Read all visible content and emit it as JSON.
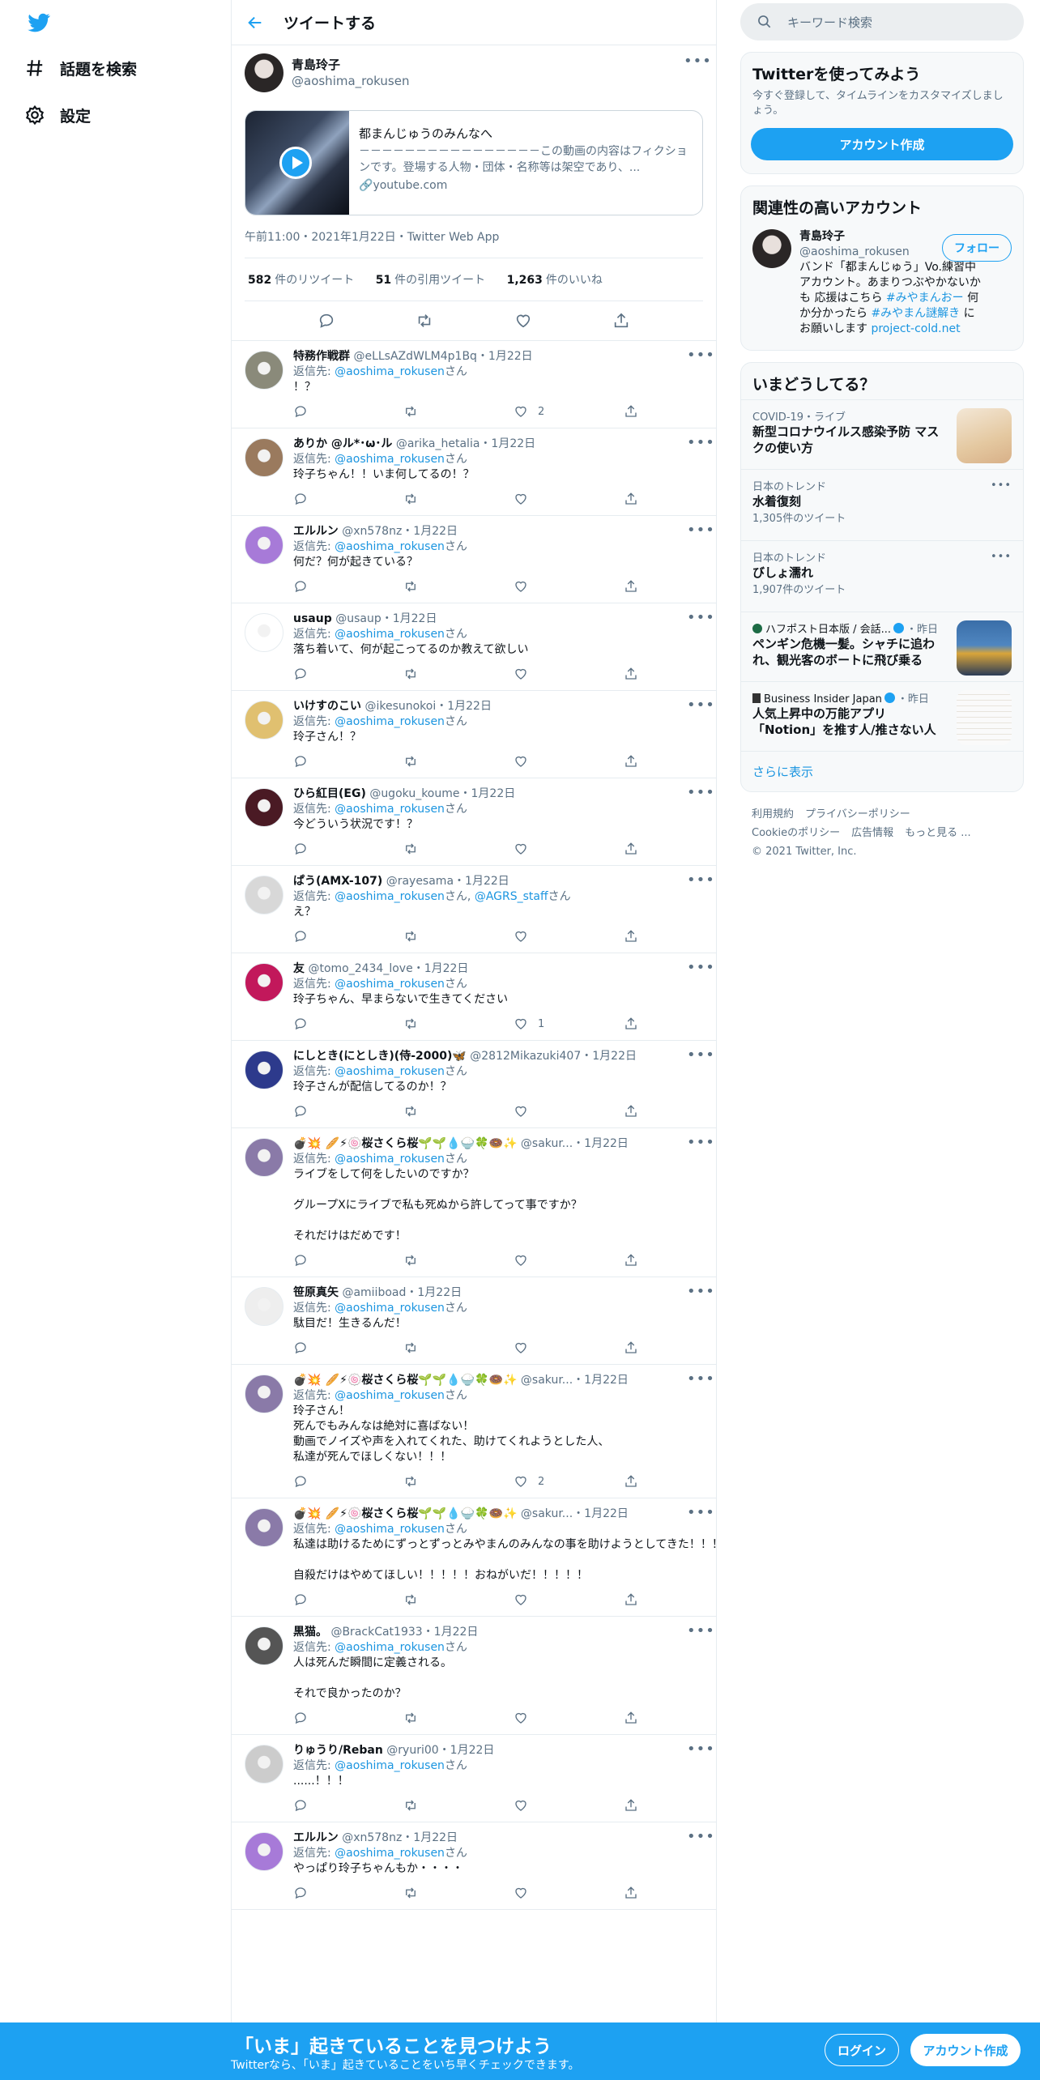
{
  "nav": {
    "explore": "話題を検索",
    "settings": "設定"
  },
  "header": {
    "title": "ツイートする"
  },
  "tweet": {
    "name": "青島玲子",
    "handle": "@aoshima_rokusen",
    "card_title": "都まんじゅうのみんなへ",
    "card_desc": "－－－－－－－－－－－－－－－－この動画の内容はフィクションです。登場する人物・団体・名称等は架空であり、...",
    "card_domain": "youtube.com",
    "time": "午前11:00・2021年1月22日・Twitter Web App",
    "retweets": "582",
    "retweets_label": "件のリツイート",
    "quotes": "51",
    "quotes_label": "件の引用ツイート",
    "likes": "1,263",
    "likes_label": "件のいいね"
  },
  "replies": [
    {
      "name": "特務作戦群",
      "handle": "@eLLsAZdWLM4p1Bq",
      "date": "・1月22日",
      "to_prefix": "返信先: ",
      "to": "@aoshima_rokusen",
      "to_suffix": "さん",
      "text": "！？",
      "likes": "2",
      "avatar": "#8a8a7a"
    },
    {
      "name": "ありか @ル*･ω･ル",
      "handle": "@arika_hetalia",
      "date": "・1月22日",
      "to_prefix": "返信先: ",
      "to": "@aoshima_rokusen",
      "to_suffix": "さん",
      "text": "玲子ちゃん！！いま何してるの！？",
      "likes": "",
      "avatar": "#9a7a5e"
    },
    {
      "name": "エルルン",
      "handle": "@xn578nz",
      "date": "・1月22日",
      "to_prefix": "返信先: ",
      "to": "@aoshima_rokusen",
      "to_suffix": "さん",
      "text": "何だ？何が起きている？",
      "likes": "",
      "avatar": "#a77ad8"
    },
    {
      "name": "usaup",
      "handle": "@usaup",
      "date": "・1月22日",
      "to_prefix": "返信先: ",
      "to": "@aoshima_rokusen",
      "to_suffix": "さん",
      "text": "落ち着いて、何が起こってるのか教えて欲しい",
      "likes": "",
      "avatar": "#ffffff"
    },
    {
      "name": "いけすのこい",
      "handle": "@ikesunokoi",
      "date": "・1月22日",
      "to_prefix": "返信先: ",
      "to": "@aoshima_rokusen",
      "to_suffix": "さん",
      "text": "玲子さん！？",
      "likes": "",
      "avatar": "#e0c070"
    },
    {
      "name": "ひら紅目(EG)",
      "handle": "@ugoku_koume",
      "date": "・1月22日",
      "to_prefix": "返信先: ",
      "to": "@aoshima_rokusen",
      "to_suffix": "さん",
      "text": "今どういう状況です！？",
      "likes": "",
      "avatar": "#4a1a24"
    },
    {
      "name": "ぱう(AMX-107)",
      "handle": "@rayesama",
      "date": "・1月22日",
      "to_prefix": "返信先: ",
      "to": "@aoshima_rokusen",
      "to_suffix": "さん, ",
      "to2": "@AGRS_staff",
      "to2_suffix": "さん",
      "text": "え？",
      "likes": "",
      "avatar": "#d8d8d8"
    },
    {
      "name": "友",
      "handle": "@tomo_2434_love",
      "date": "・1月22日",
      "to_prefix": "返信先: ",
      "to": "@aoshima_rokusen",
      "to_suffix": "さん",
      "text": "玲子ちゃん、早まらないで生きてください",
      "likes": "1",
      "avatar": "#c2185b"
    },
    {
      "name": "にしとき(にとしき)(侍-2000)🦋",
      "handle": "@2812Mikazuki407",
      "date": "・1月22日",
      "to_prefix": "返信先: ",
      "to": "@aoshima_rokusen",
      "to_suffix": "さん",
      "text": "玲子さんが配信してるのか！？",
      "likes": "",
      "avatar": "#2d3a8c"
    },
    {
      "name": "💣💥 🥖⚡🍥桜さくら桜🌱🌱💧🍚🍀🍩✨",
      "handle": "@sakur...",
      "date": "・1月22日",
      "to_prefix": "返信先: ",
      "to": "@aoshima_rokusen",
      "to_suffix": "さん",
      "text": "ライブをして何をしたいのですか？\n\nグループXにライブで私も死ぬから許してって事ですか？\n\nそれだけはだめです！",
      "likes": "",
      "avatar": "#8a7aa8"
    },
    {
      "name": "笹原真矢",
      "handle": "@amiiboad",
      "date": "・1月22日",
      "to_prefix": "返信先: ",
      "to": "@aoshima_rokusen",
      "to_suffix": "さん",
      "text": "駄目だ！生きるんだ！",
      "likes": "",
      "avatar": "#eeeeee"
    },
    {
      "name": "💣💥 🥖⚡🍥桜さくら桜🌱🌱💧🍚🍀🍩✨",
      "handle": "@sakur...",
      "date": "・1月22日",
      "to_prefix": "返信先: ",
      "to": "@aoshima_rokusen",
      "to_suffix": "さん",
      "text": "玲子さん！\n死んでもみんなは絶対に喜ばない！\n動画でノイズや声を入れてくれた、助けてくれようとした人、\n私達が死んでほしくない！！！",
      "likes": "2",
      "avatar": "#8a7aa8"
    },
    {
      "name": "💣💥 🥖⚡🍥桜さくら桜🌱🌱💧🍚🍀🍩✨",
      "handle": "@sakur...",
      "date": "・1月22日",
      "to_prefix": "返信先: ",
      "to": "@aoshima_rokusen",
      "to_suffix": "さん",
      "text": "私達は助けるためにずっとずっとみやまんのみんなの事を助けようとしてきた！！！\n\n自殺だけはやめてほしい！！！！！おねがいだ！！！！！",
      "likes": "",
      "avatar": "#8a7aa8"
    },
    {
      "name": "黒猫。",
      "handle": "@BrackCat1933",
      "date": "・1月22日",
      "to_prefix": "返信先: ",
      "to": "@aoshima_rokusen",
      "to_suffix": "さん",
      "text": "人は死んだ瞬間に定義される。\n\nそれで良かったのか？",
      "likes": "",
      "avatar": "#555555"
    },
    {
      "name": "りゅうり/Reban",
      "handle": "@ryuri00",
      "date": "・1月22日",
      "to_prefix": "返信先: ",
      "to": "@aoshima_rokusen",
      "to_suffix": "さん",
      "text": "......！！！",
      "likes": "",
      "avatar": "#cccccc"
    },
    {
      "name": "エルルン",
      "handle": "@xn578nz",
      "date": "・1月22日",
      "to_prefix": "返信先: ",
      "to": "@aoshima_rokusen",
      "to_suffix": "さん",
      "text": "やっぱり玲子ちゃんもか・・・・",
      "likes": "",
      "avatar": "#a77ad8"
    }
  ],
  "right": {
    "search_placeholder": "キーワード検索",
    "signup_title": "Twitterを使ってみよう",
    "signup_desc": "今すぐ登録して、タイムラインをカスタマイズしましょう。",
    "signup_btn": "アカウント作成",
    "relevant_title": "関連性の高いアカウント",
    "rel_name": "青島玲子",
    "rel_handle": "@aoshima_rokusen",
    "rel_follow": "フォロー",
    "rel_bio_1": "バンド「都まんじゅう」Vo.練習中アカウント。あまりつぶやかないかも 応援はこちら ",
    "rel_tag1": "#みやまんおー",
    "rel_bio_2": " 何か分かったら ",
    "rel_tag2": "#みやまん謎解き",
    "rel_bio_3": " にお願いします ",
    "rel_link": "project-cold.net",
    "trends_title": "いまどうしてる？",
    "trends": [
      {
        "cat": "COVID-19・ライブ",
        "name": "新型コロナウイルス感染予防 マスクの使い方",
        "count": ""
      },
      {
        "cat": "日本のトレンド",
        "name": "水着復刻",
        "count": "1,305件のツイート"
      },
      {
        "cat": "日本のトレンド",
        "name": "びしょ濡れ",
        "count": "1,907件のツイート"
      },
      {
        "cat": "ハフポスト日本版 / 会話...",
        "cat_suffix": "・昨日",
        "name": "ペンギン危機一髪。シャチに追われ、観光客のボートに飛び乗る",
        "count": ""
      },
      {
        "cat": "Business Insider Japan",
        "cat_suffix": "・昨日",
        "name": "人気上昇中の万能アプリ「Notion」を推す人/推さない人",
        "count": ""
      }
    ],
    "show_more": "さらに表示",
    "footer": [
      "利用規約",
      "プライバシーポリシー",
      "Cookieのポリシー",
      "広告情報",
      "もっと見る ...",
      "© 2021 Twitter, Inc."
    ]
  },
  "bottom": {
    "title": "「いま」起きていることを見つけよう",
    "sub": "Twitterなら、「いま」起きていることをいち早くチェックできます。",
    "login": "ログイン",
    "signup": "アカウント作成"
  },
  "colors": {
    "accent": "#1da1f2",
    "link": "#1b95e0",
    "muted": "#5b7083"
  }
}
